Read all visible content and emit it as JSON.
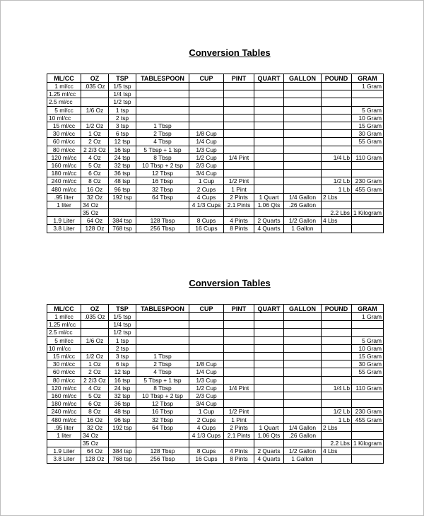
{
  "document": {
    "sections": [
      {
        "title": "Conversion Tables",
        "headers": [
          "ML/CC",
          "OZ",
          "TSP",
          "TABLESPOON",
          "CUP",
          "PINT",
          "QUART",
          "GALLON",
          "POUND",
          "GRAM"
        ],
        "rows": [
          [
            "1 ml/cc",
            ".035 Oz",
            "1/5 tsp",
            "",
            "",
            "",
            "",
            "",
            "",
            "1 Gram"
          ],
          [
            "1.25 ml/cc",
            "",
            "1/4 tsp",
            "",
            "",
            "",
            "",
            "",
            "",
            ""
          ],
          [
            "2.5 ml/cc",
            "",
            "1/2 tsp",
            "",
            "",
            "",
            "",
            "",
            "",
            ""
          ],
          [
            "5 ml/cc",
            "1/6 Oz",
            "1 tsp",
            "",
            "",
            "",
            "",
            "",
            "",
            "5 Gram"
          ],
          [
            "10 ml/cc",
            "",
            "2 tsp",
            "",
            "",
            "",
            "",
            "",
            "",
            "10 Gram"
          ],
          [
            "15 ml/cc",
            "1/2 Oz",
            "3 tsp",
            "1 Tbsp",
            "",
            "",
            "",
            "",
            "",
            "15 Gram"
          ],
          [
            "30 ml/cc",
            "1 Oz",
            "6 tsp",
            "2 Tbsp",
            "1/8 Cup",
            "",
            "",
            "",
            "",
            "30 Gram"
          ],
          [
            "60 ml/cc",
            "2 Oz",
            "12 tsp",
            "4 Tbsp",
            "1/4 Cup",
            "",
            "",
            "",
            "",
            "55 Gram"
          ],
          [
            "80 ml/cc",
            "2 2/3 Oz",
            "16 tsp",
            "5 Tbsp + 1 tsp",
            "1/3 Cup",
            "",
            "",
            "",
            "",
            ""
          ],
          [
            "120 ml/cc",
            "4 Oz",
            "24 tsp",
            "8 Tbsp",
            "1/2 Cup",
            "1/4 Pint",
            "",
            "",
            "1/4 Lb",
            "110 Gram"
          ],
          [
            "160 ml/cc",
            "5 Oz",
            "32 tsp",
            "10 Tbsp + 2 tsp",
            "2/3 Cup",
            "",
            "",
            "",
            "",
            ""
          ],
          [
            "180 ml/cc",
            "6 Oz",
            "36 tsp",
            "12 Tbsp",
            "3/4 Cup",
            "",
            "",
            "",
            "",
            ""
          ],
          [
            "240 ml/cc",
            "8 Oz",
            "48 tsp",
            "16 Tbsp",
            "1 Cup",
            "1/2 Pint",
            "",
            "",
            "1/2 Lb",
            "230 Gram"
          ],
          [
            "480 ml/cc",
            "16 Oz",
            "96 tsp",
            "32 Tbsp",
            "2 Cups",
            "1 Pint",
            "",
            "",
            "1 Lb",
            "455 Gram"
          ],
          [
            ".95 liter",
            "32 Oz",
            "192 tsp",
            "64 Tbsp",
            "4 Cups",
            "2 Pints",
            "1 Quart",
            "1/4 Gallon",
            "2 Lbs",
            ""
          ],
          [
            "1 liter",
            "34 Oz",
            "",
            "",
            "4 1/3 Cups",
            "2.1 Pints",
            "1.06 Qts",
            ".26 Gallon",
            "",
            ""
          ],
          [
            "",
            "35 Oz",
            "",
            "",
            "",
            "",
            "",
            "",
            "2.2 Lbs",
            "1 Kilogram"
          ],
          [
            "1.9 Liter",
            "64 Oz",
            "384 tsp",
            "128 Tbsp",
            "8 Cups",
            "4 Pints",
            "2 Quarts",
            "1/2 Gallon",
            "4 Lbs",
            ""
          ],
          [
            "3.8 Liter",
            "128 Oz",
            "768 tsp",
            "256 Tbsp",
            "16 Cups",
            "8 Pints",
            "4 Quarts",
            "1 Gallon",
            "",
            ""
          ]
        ]
      },
      {
        "title": "Conversion Tables",
        "headers": [
          "ML/CC",
          "OZ",
          "TSP",
          "TABLESPOON",
          "CUP",
          "PINT",
          "QUART",
          "GALLON",
          "POUND",
          "GRAM"
        ],
        "rows": [
          [
            "1 ml/cc",
            ".035 Oz",
            "1/5 tsp",
            "",
            "",
            "",
            "",
            "",
            "",
            "1 Gram"
          ],
          [
            "1.25 ml/cc",
            "",
            "1/4 tsp",
            "",
            "",
            "",
            "",
            "",
            "",
            ""
          ],
          [
            "2.5 ml/cc",
            "",
            "1/2 tsp",
            "",
            "",
            "",
            "",
            "",
            "",
            ""
          ],
          [
            "5 ml/cc",
            "1/6 Oz",
            "1 tsp",
            "",
            "",
            "",
            "",
            "",
            "",
            "5 Gram"
          ],
          [
            "10 ml/cc",
            "",
            "2 tsp",
            "",
            "",
            "",
            "",
            "",
            "",
            "10 Gram"
          ],
          [
            "15 ml/cc",
            "1/2 Oz",
            "3 tsp",
            "1 Tbsp",
            "",
            "",
            "",
            "",
            "",
            "15 Gram"
          ],
          [
            "30 ml/cc",
            "1 Oz",
            "6 tsp",
            "2 Tbsp",
            "1/8 Cup",
            "",
            "",
            "",
            "",
            "30 Gram"
          ],
          [
            "60 ml/cc",
            "2 Oz",
            "12 tsp",
            "4 Tbsp",
            "1/4 Cup",
            "",
            "",
            "",
            "",
            "55 Gram"
          ],
          [
            "80 ml/cc",
            "2 2/3 Oz",
            "16 tsp",
            "5 Tbsp + 1 tsp",
            "1/3 Cup",
            "",
            "",
            "",
            "",
            ""
          ],
          [
            "120 ml/cc",
            "4 Oz",
            "24 tsp",
            "8 Tbsp",
            "1/2 Cup",
            "1/4 Pint",
            "",
            "",
            "1/4 Lb",
            "110 Gram"
          ],
          [
            "160 ml/cc",
            "5 Oz",
            "32 tsp",
            "10 Tbsp + 2 tsp",
            "2/3 Cup",
            "",
            "",
            "",
            "",
            ""
          ],
          [
            "180 ml/cc",
            "6 Oz",
            "36 tsp",
            "12 Tbsp",
            "3/4 Cup",
            "",
            "",
            "",
            "",
            ""
          ],
          [
            "240 ml/cc",
            "8 Oz",
            "48 tsp",
            "16 Tbsp",
            "1 Cup",
            "1/2 Pint",
            "",
            "",
            "1/2 Lb",
            "230 Gram"
          ],
          [
            "480 ml/cc",
            "16 Oz",
            "96 tsp",
            "32 Tbsp",
            "2 Cups",
            "1 Pint",
            "",
            "",
            "1 Lb",
            "455 Gram"
          ],
          [
            ".95 liter",
            "32 Oz",
            "192 tsp",
            "64 Tbsp",
            "4 Cups",
            "2 Pints",
            "1 Quart",
            "1/4 Gallon",
            "2 Lbs",
            ""
          ],
          [
            "1 liter",
            "34 Oz",
            "",
            "",
            "4 1/3 Cups",
            "2.1 Pints",
            "1.06 Qts",
            ".26 Gallon",
            "",
            ""
          ],
          [
            "",
            "35 Oz",
            "",
            "",
            "",
            "",
            "",
            "",
            "2.2 Lbs",
            "1 Kilogram"
          ],
          [
            "1.9 Liter",
            "64 Oz",
            "384 tsp",
            "128 Tbsp",
            "8 Cups",
            "4 Pints",
            "2 Quarts",
            "1/2 Gallon",
            "4 Lbs",
            ""
          ],
          [
            "3.8 Liter",
            "128 Oz",
            "768 tsp",
            "256 Tbsp",
            "16 Cups",
            "8 Pints",
            "4 Quarts",
            "1 Gallon",
            "",
            ""
          ]
        ]
      }
    ]
  }
}
